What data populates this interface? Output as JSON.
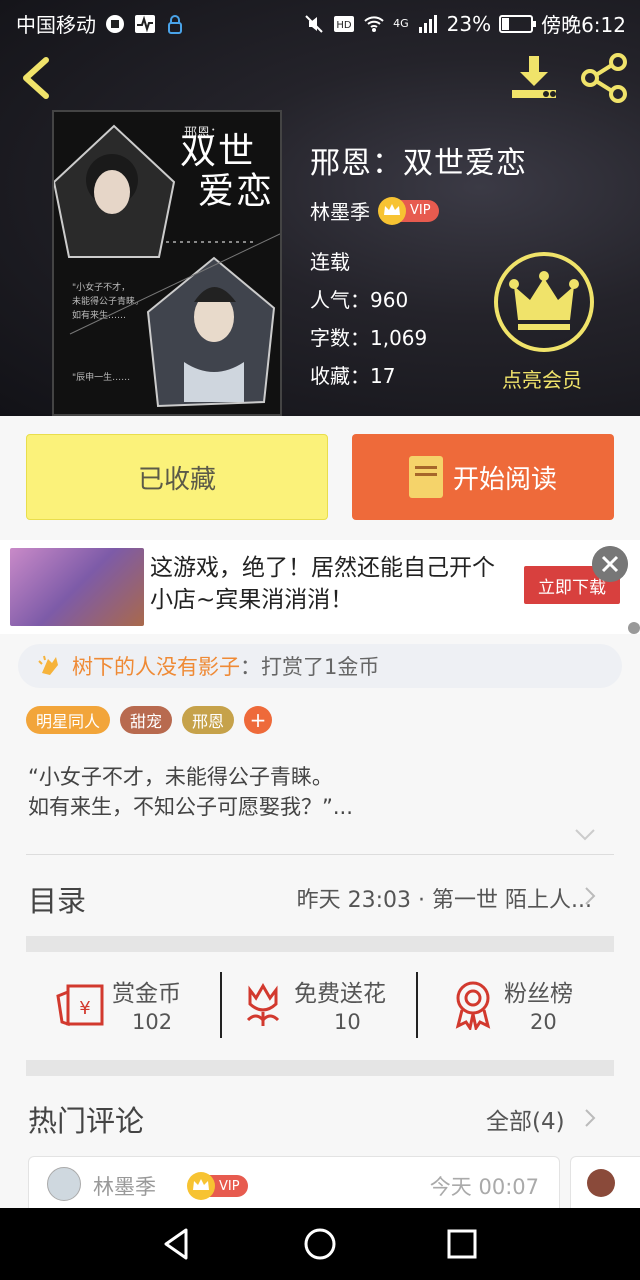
{
  "status": {
    "carrier": "中国移动",
    "network": "4G",
    "battery": "23%",
    "battery_level": 0.23,
    "time": "傍晚6:12"
  },
  "book": {
    "title": "邢恩：双世爱恋",
    "author": "林墨季",
    "vip_badge": "VIP",
    "status": "连载",
    "popularity": "人气：960",
    "word_count": "字数：1,069",
    "favorites": "收藏：17",
    "cover_title_line1": "双世",
    "cover_title_line2": "爱恋",
    "cover_subtitle": "邢恩："
  },
  "member": {
    "label": "点亮会员"
  },
  "actions": {
    "favorited_label": "已收藏",
    "read_label": "开始阅读"
  },
  "ad": {
    "text": "这游戏，绝了！居然还能自己开个小店~宾果消消消！",
    "cta": "立即下载"
  },
  "tip": {
    "user": "树下的人没有影子",
    "action": "：打赏了1金币"
  },
  "tags": [
    {
      "label": "明星同人",
      "color": "#f2a53a"
    },
    {
      "label": "甜宠",
      "color": "#b86a4f"
    },
    {
      "label": "邢恩",
      "color": "#c6a24a"
    }
  ],
  "tag_plus": "+",
  "intro": {
    "line1": "“小女子不才，未能得公子青睐。",
    "line2": "如有来生，不知公子可愿娶我？”..."
  },
  "toc": {
    "title": "目录",
    "latest": "昨天 23:03 · 第一世 陌上人..."
  },
  "stats": [
    {
      "label": "赏金币",
      "value": "102",
      "icon": "red-envelope-icon"
    },
    {
      "label": "免费送花",
      "value": "10",
      "icon": "flower-icon"
    },
    {
      "label": "粉丝榜",
      "value": "20",
      "icon": "medal-icon"
    }
  ],
  "comments_section": {
    "title": "热门评论",
    "all_label": "全部(4)"
  },
  "comments": [
    {
      "user": "林墨季",
      "vip": "VIP",
      "time": "今天 00:07"
    }
  ],
  "colors": {
    "accent_orange": "#ee6a3a",
    "favorite_yellow": "#fbf27a",
    "member_gold": "#f0e36a",
    "vip_red": "#e75b4f"
  }
}
